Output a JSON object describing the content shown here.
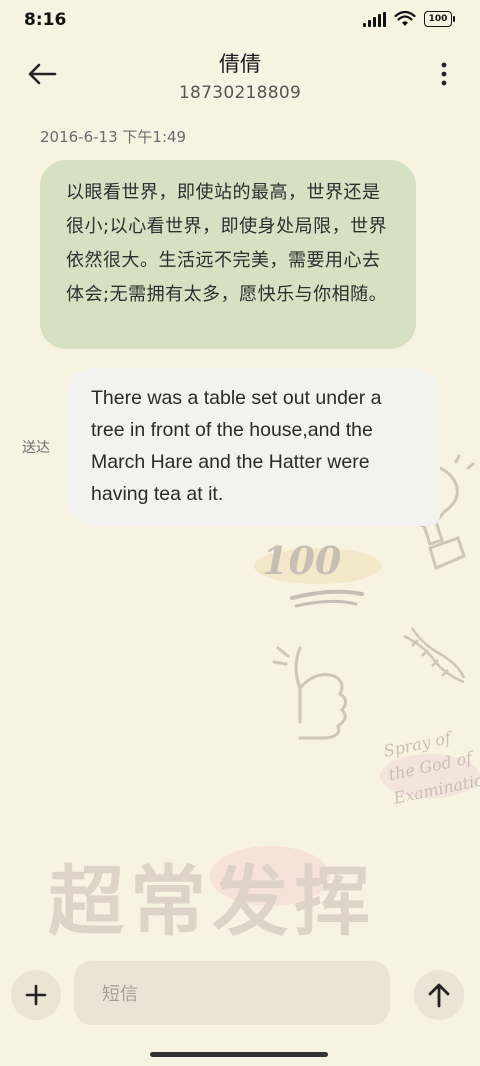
{
  "status_bar": {
    "time": "8:16",
    "battery": "100",
    "icons": [
      "signal-icon",
      "wifi-icon",
      "battery-icon"
    ]
  },
  "header": {
    "contact_name": "倩倩",
    "phone_number": "18730218809",
    "back_icon": "arrow-left-icon",
    "more_icon": "more-vertical-icon"
  },
  "conversation": {
    "timestamp": "2016-6-13 下午1:49",
    "messages": [
      {
        "direction": "incoming",
        "text": "以眼看世界，即使站的最高，世界还是很小;以心看世界，即使身处局限，世界依然很大。生活远不完美，需要用心去体会;无需拥有太多，愿快乐与你相随。"
      },
      {
        "direction": "outgoing",
        "text": "There was a table set out under a tree in front of the house,and the March Hare and the Hatter were having tea at it.",
        "status": "送达"
      }
    ]
  },
  "theme": {
    "big_text": "超常发挥",
    "spray_text": [
      "Spray of",
      "the God of",
      "Examinatio"
    ],
    "score_text": "100"
  },
  "input_bar": {
    "placeholder": "短信",
    "add_icon": "plus-icon",
    "send_icon": "arrow-up-icon"
  },
  "colors": {
    "background": "#f8f2e1",
    "incoming_bubble": "#d6e1c3",
    "outgoing_bubble": "#f2f3ef",
    "control_bg": "#ebe4d4"
  }
}
